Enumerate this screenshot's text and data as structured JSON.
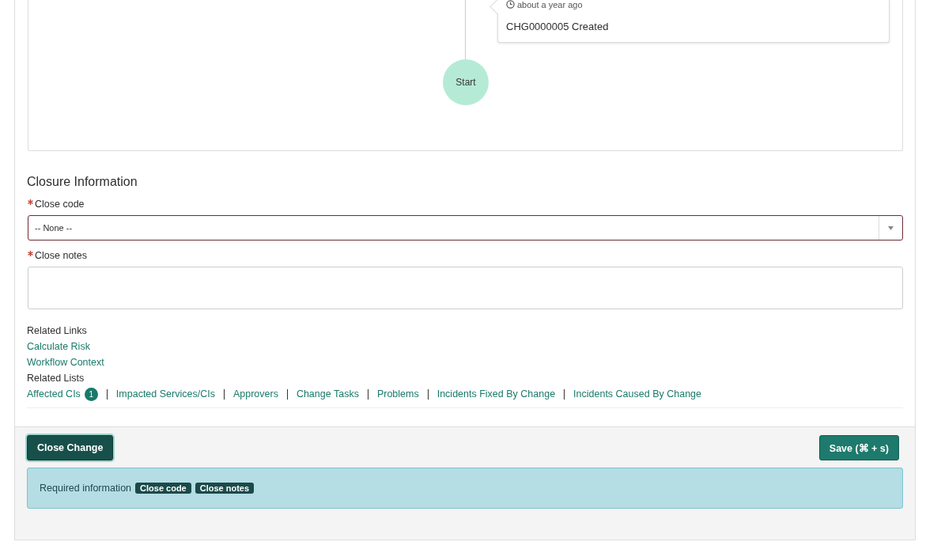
{
  "timeline": {
    "entry": {
      "time": "about a year ago",
      "text": "CHG0000005 Created"
    },
    "start_label": "Start"
  },
  "closure": {
    "title": "Closure Information",
    "fields": [
      {
        "kind": "select",
        "label": "Close code",
        "required": true,
        "value": "-- None --"
      },
      {
        "kind": "textarea",
        "label": "Close notes",
        "required": true
      }
    ]
  },
  "related_links": {
    "title": "Related Links",
    "links": [
      "Calculate Risk",
      "Workflow Context"
    ]
  },
  "related_lists": {
    "title": "Related Lists",
    "items": [
      {
        "label": "Affected CIs",
        "count": "1"
      },
      {
        "label": "Impacted Services/CIs"
      },
      {
        "label": "Approvers"
      },
      {
        "label": "Change Tasks"
      },
      {
        "label": "Problems"
      },
      {
        "label": "Incidents Fixed By Change"
      },
      {
        "label": "Incidents Caused By Change"
      }
    ]
  },
  "footer": {
    "primary_button": "Close Change",
    "save_button": "Save (⌘ + s)",
    "required": {
      "text": "Required information",
      "tags": [
        "Close code",
        "Close notes"
      ]
    }
  }
}
